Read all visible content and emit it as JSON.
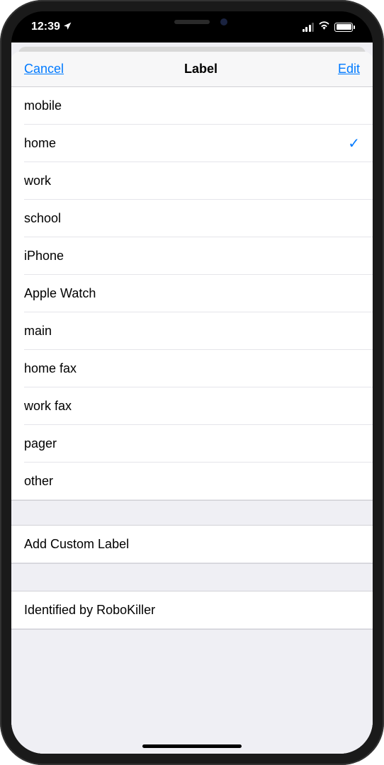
{
  "statusBar": {
    "time": "12:39"
  },
  "nav": {
    "cancel": "Cancel",
    "title": "Label",
    "edit": "Edit"
  },
  "labels": {
    "items": [
      {
        "name": "mobile",
        "selected": false
      },
      {
        "name": "home",
        "selected": true
      },
      {
        "name": "work",
        "selected": false
      },
      {
        "name": "school",
        "selected": false
      },
      {
        "name": "iPhone",
        "selected": false
      },
      {
        "name": "Apple Watch",
        "selected": false
      },
      {
        "name": "main",
        "selected": false
      },
      {
        "name": "home fax",
        "selected": false
      },
      {
        "name": "work fax",
        "selected": false
      },
      {
        "name": "pager",
        "selected": false
      },
      {
        "name": "other",
        "selected": false
      }
    ]
  },
  "customSection": {
    "addLabel": "Add Custom Label"
  },
  "extraSection": {
    "identified": "Identified by RoboKiller"
  }
}
